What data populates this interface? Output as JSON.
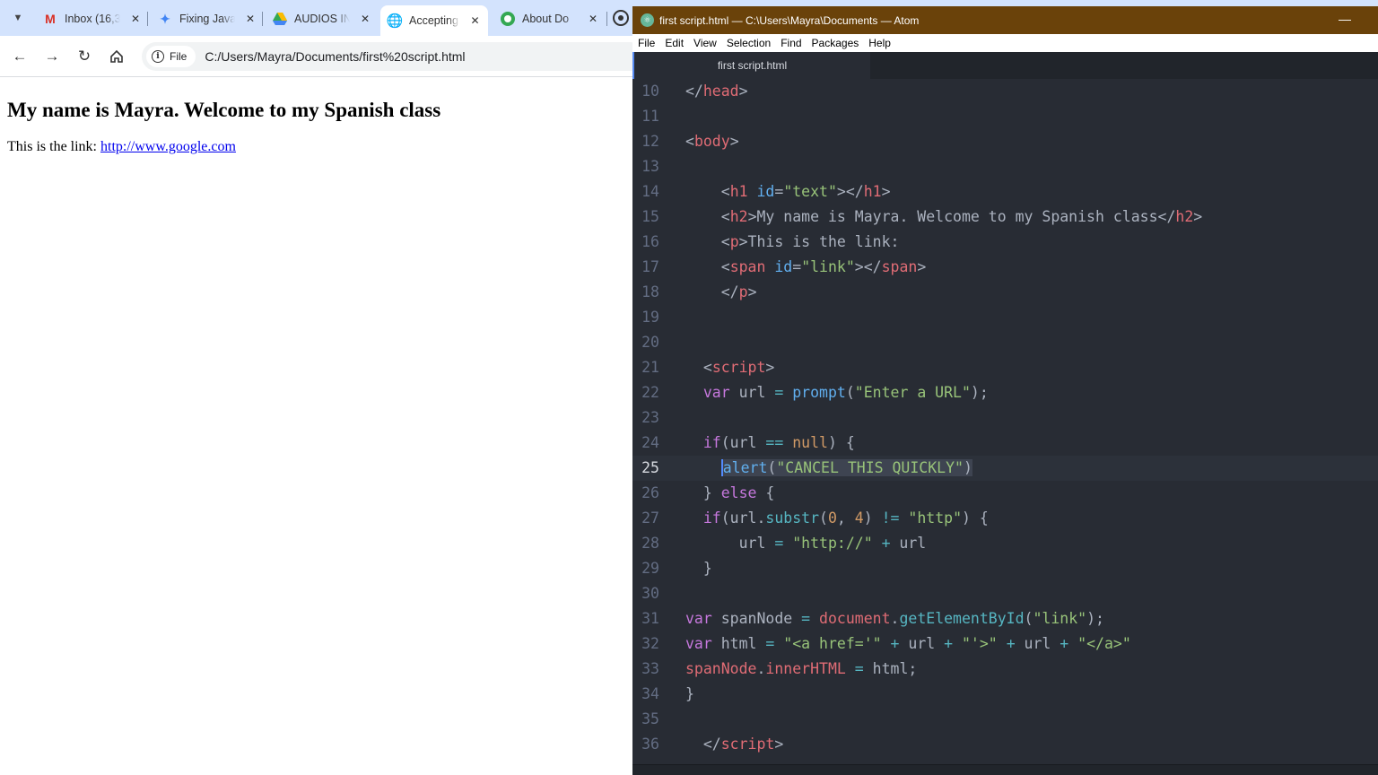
{
  "browser": {
    "tabs": [
      {
        "icon": "gmail-icon",
        "label": "Inbox (16,3"
      },
      {
        "icon": "gemini-icon",
        "label": "Fixing Java"
      },
      {
        "icon": "drive-icon",
        "label": "AUDIOS IN"
      },
      {
        "icon": "globe-icon",
        "label": "Accepting",
        "active": true
      },
      {
        "icon": "about-icon",
        "label": "About Do"
      }
    ],
    "omnibox": {
      "chip_label": "File",
      "url": "C:/Users/Mayra/Documents/first%20script.html"
    },
    "page": {
      "heading": "My name is Mayra. Welcome to my Spanish class",
      "para_prefix": "This is the link: ",
      "link_text": "http://www.google.com"
    }
  },
  "atom": {
    "window_title": "first script.html — C:\\Users\\Mayra\\Documents — Atom",
    "menu": [
      "File",
      "Edit",
      "View",
      "Selection",
      "Find",
      "Packages",
      "Help"
    ],
    "active_tab": "first script.html",
    "line_numbers": [
      "10",
      "11",
      "12",
      "13",
      "14",
      "15",
      "16",
      "17",
      "18",
      "19",
      "20",
      "21",
      "22",
      "23",
      "24",
      "25",
      "26",
      "27",
      "28",
      "29",
      "30",
      "31",
      "32",
      "33",
      "34",
      "35",
      "36"
    ]
  }
}
